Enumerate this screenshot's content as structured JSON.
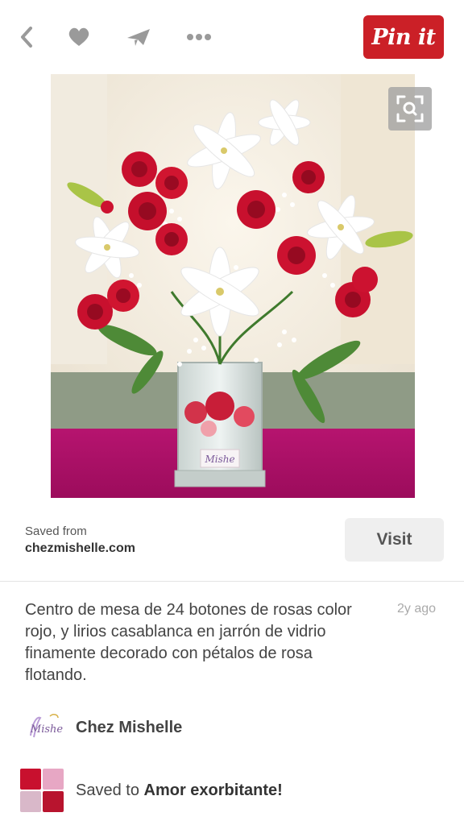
{
  "toolbar": {
    "back_icon": "chevron-left-icon",
    "like_icon": "heart-icon",
    "send_icon": "paper-plane-icon",
    "more_icon": "ellipsis-icon",
    "pin_button_label": "Pin it",
    "icon_color": "#999999",
    "pin_button_color": "#cb2027"
  },
  "image": {
    "alt": "Centro de mesa de rosas rojas y lirios blancos en jarrón de vidrio",
    "vase_label": "Mishe",
    "zoom_icon": "visual-search-icon"
  },
  "source": {
    "label": "Saved from",
    "domain": "chezmishelle.com",
    "visit_label": "Visit"
  },
  "description": {
    "text": "Centro de mesa de 24 botones de rosas color rojo, y lirios casablanca en jarrón de vidrio finamente decorado con pétalos de rosa flotando.",
    "timestamp": "2y ago"
  },
  "pinner": {
    "name": "Chez Mishelle",
    "avatar_text": "Mishe"
  },
  "board": {
    "prefix": "Saved to",
    "name": "Amor exorbitante!"
  }
}
